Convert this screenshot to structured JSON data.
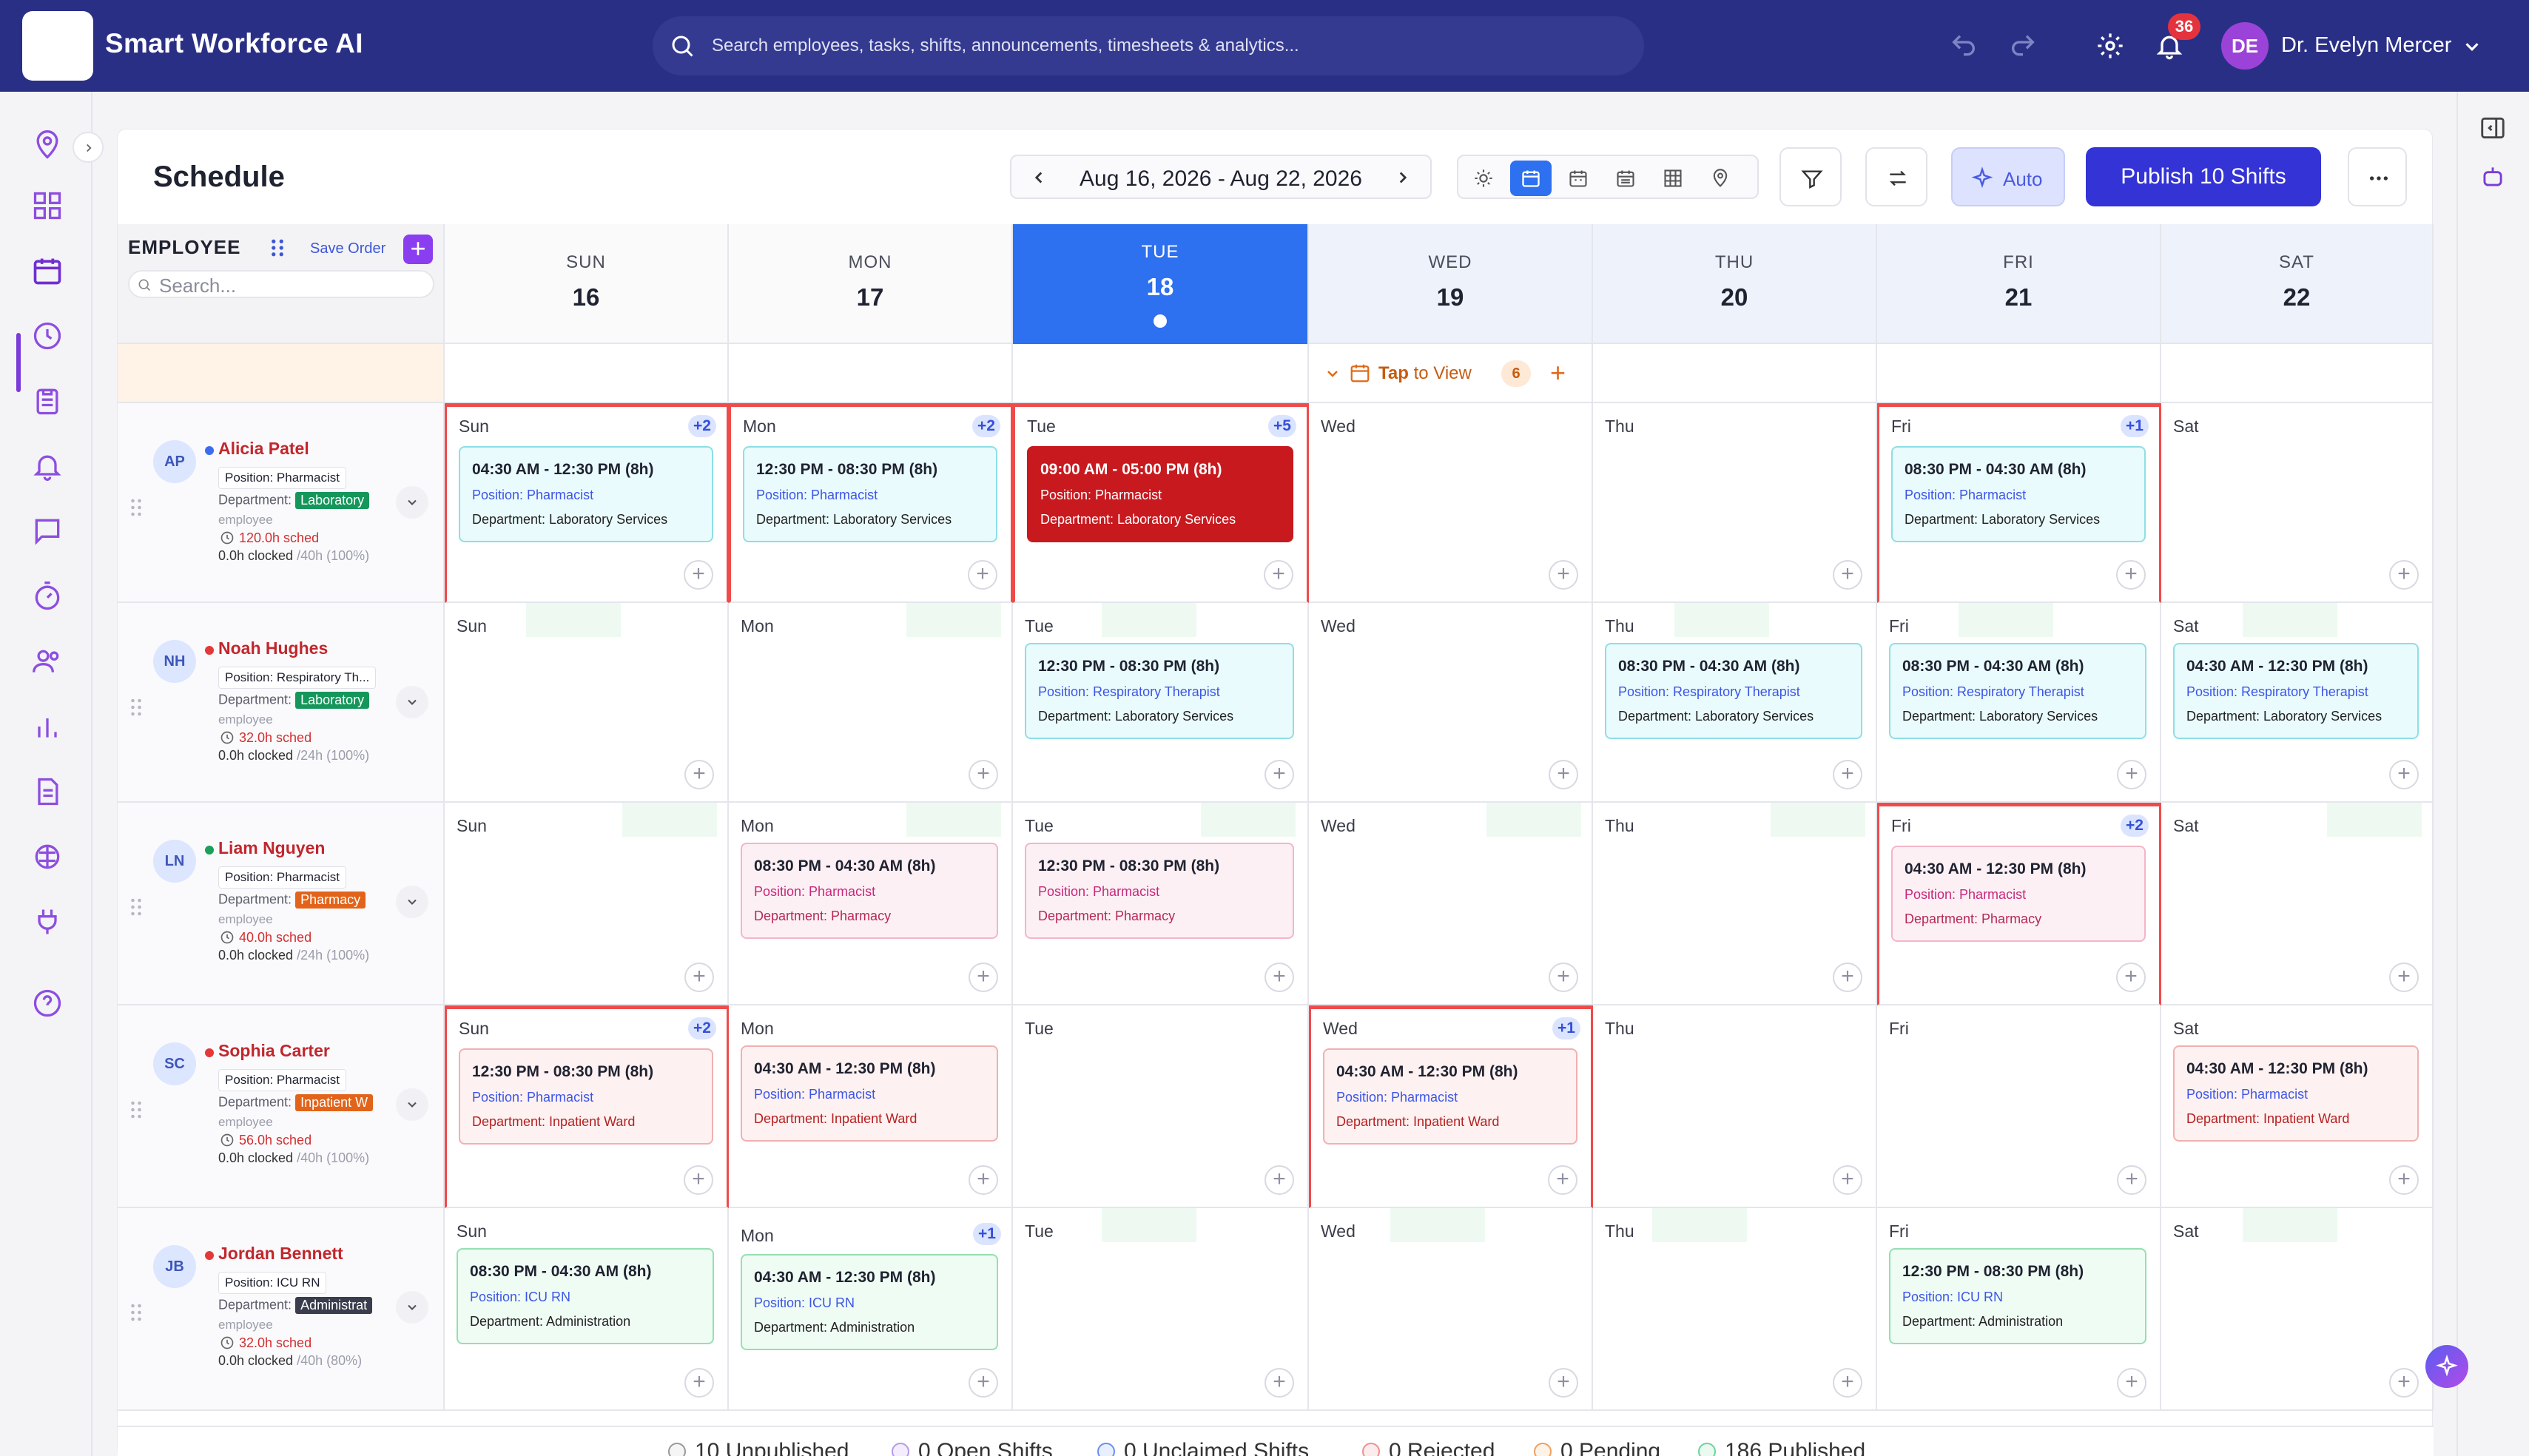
{
  "app": {
    "title": "Smart Workforce AI"
  },
  "search": {
    "placeholder": "Search employees, tasks, shifts, announcements, timesheets & analytics..."
  },
  "topbar": {
    "notifications_count": "36",
    "user_initials": "DE",
    "user_name": "Dr. Evelyn Mercer"
  },
  "page": {
    "title": "Schedule",
    "date_range": "Aug 16, 2026 - Aug 22, 2026",
    "auto_label": "Auto",
    "publish_label": "Publish 10 Shifts"
  },
  "emp_header": {
    "label": "EMPLOYEE",
    "save_order": "Save Order",
    "search_placeholder": "Search..."
  },
  "days": [
    {
      "name": "SUN",
      "date": "16",
      "short": "Sun"
    },
    {
      "name": "MON",
      "date": "17",
      "short": "Mon"
    },
    {
      "name": "TUE",
      "date": "18",
      "short": "Tue"
    },
    {
      "name": "WED",
      "date": "19",
      "short": "Wed"
    },
    {
      "name": "THU",
      "date": "20",
      "short": "Thu"
    },
    {
      "name": "FRI",
      "date": "21",
      "short": "Fri"
    },
    {
      "name": "SAT",
      "date": "22",
      "short": "Sat"
    }
  ],
  "announcement": {
    "label_tap": "Tap",
    "label_view": "to View",
    "count": "6"
  },
  "employees": [
    {
      "initials": "AP",
      "name": "Alicia Patel",
      "position": "Position: Pharmacist",
      "dept_label": "Department:",
      "dept": "Laboratory",
      "role": "employee",
      "scheduled": "120.0h sched",
      "clocked": "0.0h clocked",
      "target": "/40h (100%)"
    },
    {
      "initials": "NH",
      "name": "Noah Hughes",
      "position": "Position: Respiratory Th...",
      "dept_label": "Department:",
      "dept": "Laboratory",
      "role": "employee",
      "scheduled": "32.0h sched",
      "clocked": "0.0h clocked",
      "target": "/24h (100%)"
    },
    {
      "initials": "LN",
      "name": "Liam Nguyen",
      "position": "Position: Pharmacist",
      "dept_label": "Department:",
      "dept": "Pharmacy",
      "role": "employee",
      "scheduled": "40.0h sched",
      "clocked": "0.0h clocked",
      "target": "/24h (100%)"
    },
    {
      "initials": "SC",
      "name": "Sophia Carter",
      "position": "Position: Pharmacist",
      "dept_label": "Department:",
      "dept": "Inpatient W",
      "role": "employee",
      "scheduled": "56.0h sched",
      "clocked": "0.0h clocked",
      "target": "/40h (100%)"
    },
    {
      "initials": "JB",
      "name": "Jordan Bennett",
      "position": "Position: ICU RN",
      "dept_label": "Department:",
      "dept": "Administrat",
      "role": "employee",
      "scheduled": "32.0h sched",
      "clocked": "0.0h clocked",
      "target": "/40h (80%)"
    }
  ],
  "colors": {
    "laboratory": "#15965a",
    "pharmacy": "#e2641a",
    "inpatient": "#e2641a",
    "administration": "#3a3d4d",
    "accent": "#3433d6",
    "conflict": "#ef4b4b"
  },
  "shifts": {
    "r0": [
      {
        "time": "04:30 AM - 12:30 PM (8h)",
        "position": "Position: Pharmacist",
        "dept": "Department: Laboratory Services",
        "more": "+2"
      },
      {
        "time": "12:30 PM - 08:30 PM (8h)",
        "position": "Position: Pharmacist",
        "dept": "Department: Laboratory Services",
        "more": "+2"
      },
      {
        "time": "09:00 AM - 05:00 PM (8h)",
        "position": "Position: Pharmacist",
        "dept": "Department: Laboratory Services",
        "more": "+5"
      },
      {
        "time": "08:30 PM - 04:30 AM (8h)",
        "position": "Position: Pharmacist",
        "dept": "Department: Laboratory Services",
        "more": "+1"
      }
    ],
    "r1": [
      {
        "time": "12:30 PM - 08:30 PM (8h)",
        "position": "Position: Respiratory Therapist",
        "dept": "Department: Laboratory Services"
      },
      {
        "time": "08:30 PM - 04:30 AM (8h)",
        "position": "Position: Respiratory Therapist",
        "dept": "Department: Laboratory Services"
      },
      {
        "time": "08:30 PM - 04:30 AM (8h)",
        "position": "Position: Respiratory Therapist",
        "dept": "Department: Laboratory Services"
      },
      {
        "time": "04:30 AM - 12:30 PM (8h)",
        "position": "Position: Respiratory Therapist",
        "dept": "Department: Laboratory Services"
      }
    ],
    "r2": [
      {
        "time": "08:30 PM - 04:30 AM (8h)",
        "position": "Position: Pharmacist",
        "dept": "Department: Pharmacy"
      },
      {
        "time": "12:30 PM - 08:30 PM (8h)",
        "position": "Position: Pharmacist",
        "dept": "Department: Pharmacy"
      },
      {
        "time": "04:30 AM - 12:30 PM (8h)",
        "position": "Position: Pharmacist",
        "dept": "Department: Pharmacy",
        "more": "+2"
      }
    ],
    "r3": [
      {
        "time": "12:30 PM - 08:30 PM (8h)",
        "position": "Position: Pharmacist",
        "dept": "Department: Inpatient Ward",
        "more": "+2"
      },
      {
        "time": "04:30 AM - 12:30 PM (8h)",
        "position": "Position: Pharmacist",
        "dept": "Department: Inpatient Ward"
      },
      {
        "time": "04:30 AM - 12:30 PM (8h)",
        "position": "Position: Pharmacist",
        "dept": "Department: Inpatient Ward",
        "more": "+1"
      },
      {
        "time": "04:30 AM - 12:30 PM (8h)",
        "position": "Position: Pharmacist",
        "dept": "Department: Inpatient Ward"
      }
    ],
    "r4": [
      {
        "time": "08:30 PM - 04:30 AM (8h)",
        "position": "Position: ICU RN",
        "dept": "Department: Administration"
      },
      {
        "time": "04:30 AM - 12:30 PM (8h)",
        "position": "Position: ICU RN",
        "dept": "Department: Administration",
        "more": "+1"
      },
      {
        "time": "12:30 PM - 08:30 PM (8h)",
        "position": "Position: ICU RN",
        "dept": "Department: Administration"
      }
    ]
  },
  "legend": [
    "10 Unpublished",
    "0 Open Shifts",
    "0 Unclaimed Shifts",
    "0 Rejected",
    "0 Pending",
    "186 Published"
  ]
}
